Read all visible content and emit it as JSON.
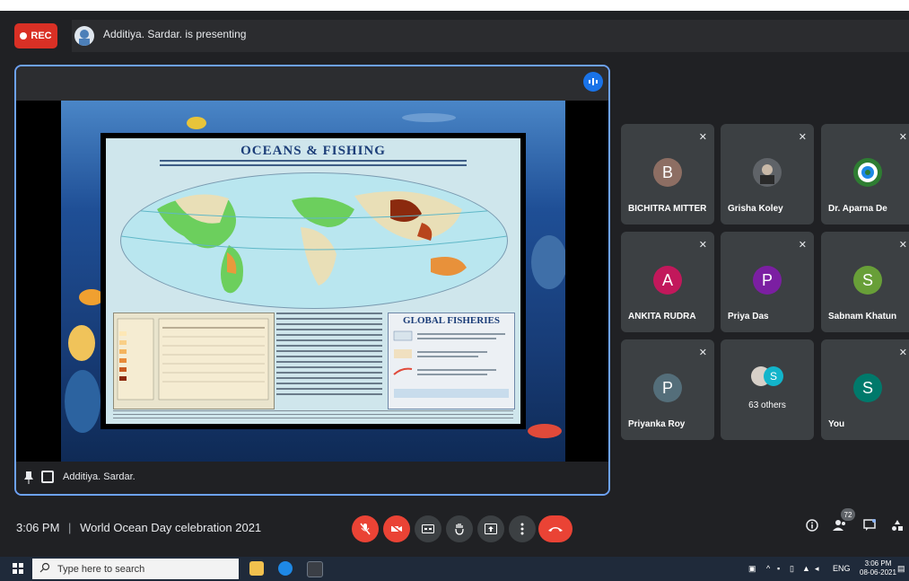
{
  "topbar": {
    "rec_label": "REC",
    "presenting_text": "Additiya. Sardar. is presenting"
  },
  "stage": {
    "presenter_name": "Additiya. Sardar.",
    "slide": {
      "title": "OCEANS & FISHING",
      "global_fisheries": "GLOBAL FISHERIES"
    }
  },
  "participants": [
    {
      "initial": "B",
      "name": "BICHITRA MITTER",
      "color": "#8d6e63"
    },
    {
      "initial": "",
      "name": "Grisha Koley",
      "color": "#5f6368"
    },
    {
      "initial": "",
      "name": "Dr. Aparna De",
      "color": "#2e7d32"
    },
    {
      "initial": "A",
      "name": "ANKITA RUDRA",
      "color": "#c2185b"
    },
    {
      "initial": "P",
      "name": "Priya Das",
      "color": "#7b1fa2"
    },
    {
      "initial": "S",
      "name": "Sabnam Khatun",
      "color": "#689f38"
    },
    {
      "initial": "P",
      "name": "Priyanka Roy",
      "color": "#546e7a"
    },
    {
      "initial": "S",
      "name": "63 others",
      "color": "#12b5cb"
    },
    {
      "initial": "S",
      "name": "You",
      "color": "#00796b"
    }
  ],
  "bottombar": {
    "time": "3:06 PM",
    "meeting_title": "World Ocean Day celebration 2021",
    "people_count": "72"
  },
  "taskbar": {
    "search_placeholder": "Type here to search",
    "lang": "ENG",
    "time": "3:06 PM",
    "date": "08-06-2021"
  }
}
